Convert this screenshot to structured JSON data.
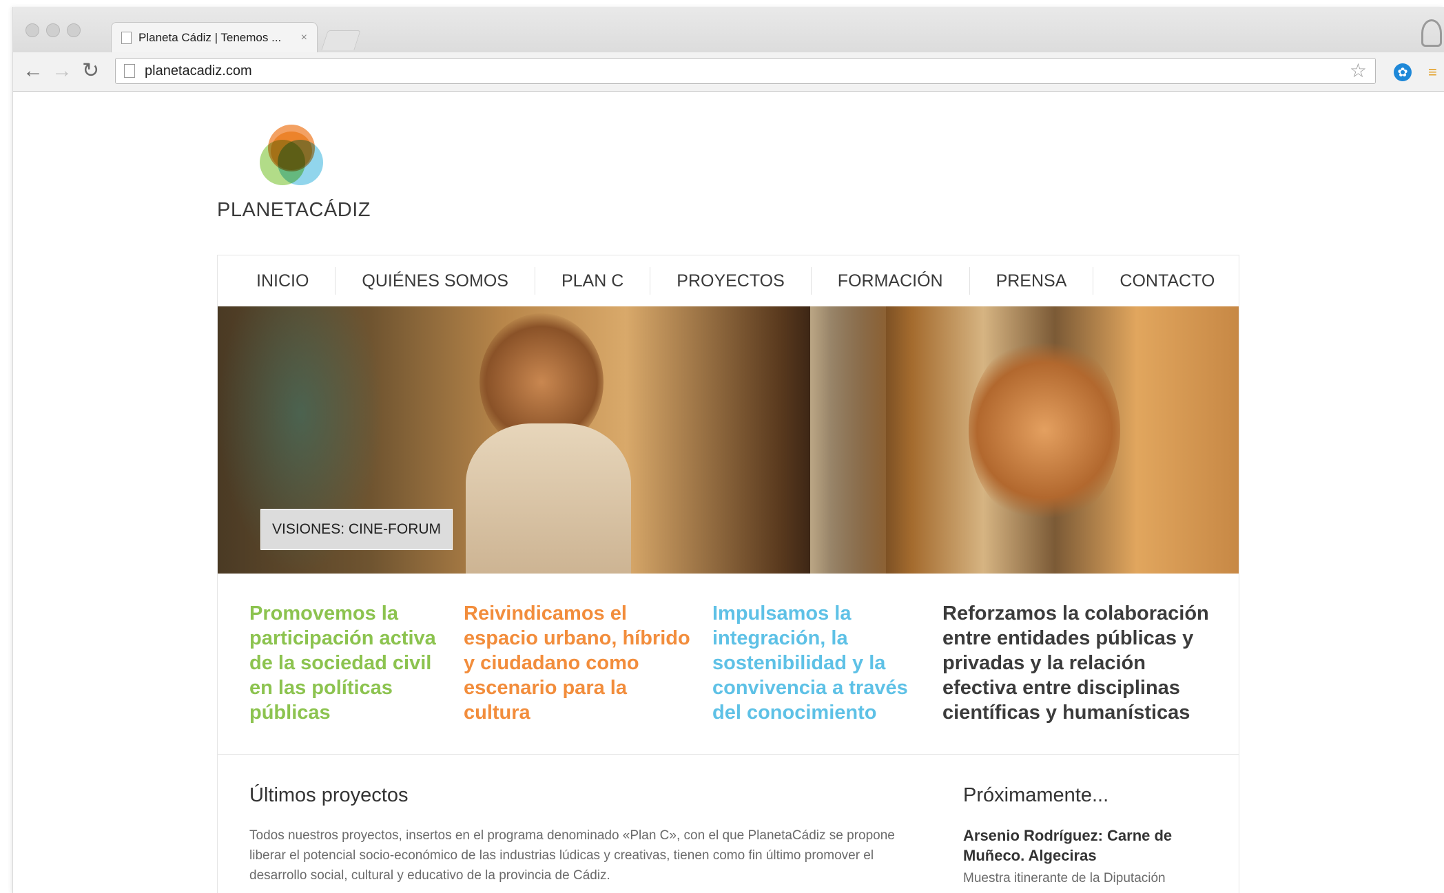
{
  "browser": {
    "tab_title": "Planeta Cádiz | Tenemos ...",
    "tab_close": "×",
    "url": "planetacadiz.com",
    "icons": {
      "back": "back-arrow-icon",
      "forward": "forward-arrow-icon",
      "reload": "reload-icon",
      "star": "star-icon",
      "extension": "extension-icon",
      "menu": "menu-icon"
    }
  },
  "site": {
    "logo_text": "PLANETACÁDIZ",
    "nav": [
      "INICIO",
      "QUIÉNES SOMOS",
      "PLAN C",
      "PROYECTOS",
      "FORMACIÓN",
      "PRENSA",
      "CONTACTO"
    ],
    "hero_label": "VISIONES: CINE-FORUM",
    "missions": [
      {
        "text": "Promovemos la participación activa de la sociedad civil en las políticas públicas",
        "color": "#8cc34f"
      },
      {
        "text": "Reivindicamos el espacio urbano, híbrido y ciudadano como escenario para la cultura",
        "color": "#f28d3c"
      },
      {
        "text": "Impulsamos la integración, la sostenibilidad y la convivencia a través del conocimiento",
        "color": "#5ec1e6"
      },
      {
        "text": "Reforzamos la colaboración entre entidades públicas y privadas y la relación efectiva entre disciplinas científicas y humanísticas",
        "color": "#3b3b3b"
      }
    ],
    "projects": {
      "title": "Últimos proyectos",
      "text": "Todos nuestros proyectos, insertos en el programa denominado «Plan C», con el que PlanetaCádiz se propone liberar el potencial socio-económico de las industrias lúdicas y creativas, tienen como fin último promover el desarrollo social, cultural y educativo de la provincia de Cádiz."
    },
    "upcoming": {
      "title": "Próximamente...",
      "event_title": "Arsenio Rodríguez: Carne de Muñeco. Algeciras",
      "event_desc": "Muestra itinerante de la Diputación"
    }
  }
}
